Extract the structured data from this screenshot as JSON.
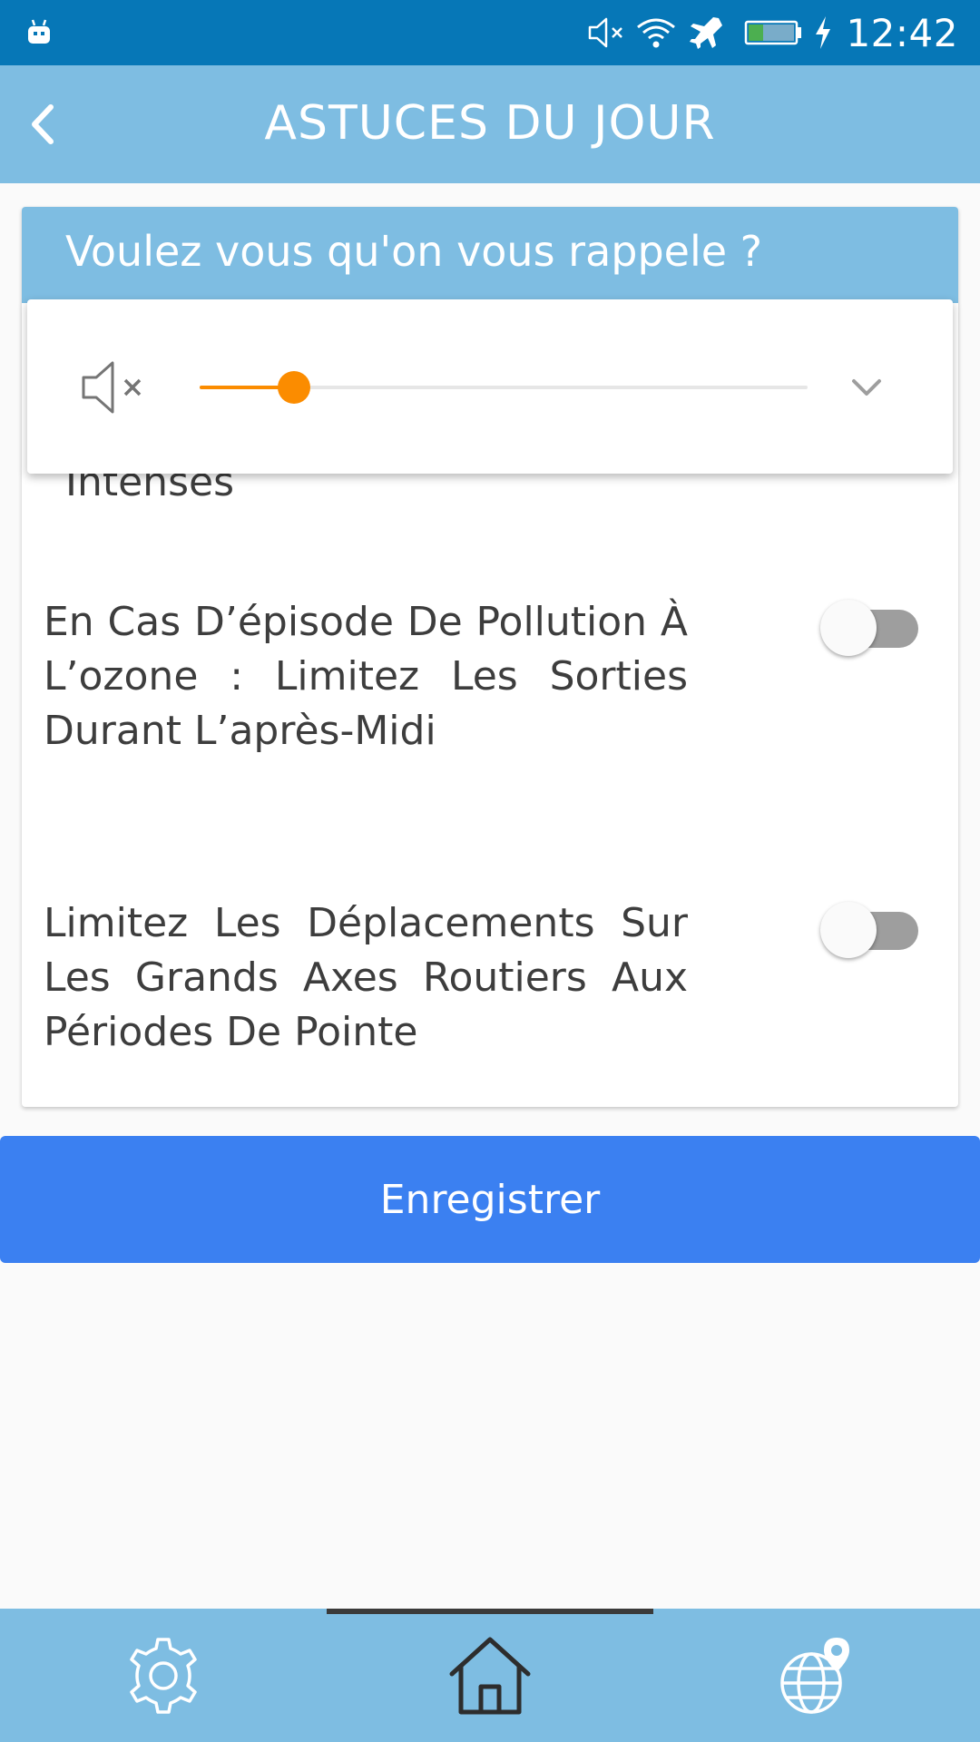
{
  "status_bar": {
    "time": "12:42",
    "icons": [
      "android-debug-icon",
      "volume-muted-icon",
      "wifi-icon",
      "airplane-mode-icon",
      "battery-charging-icon"
    ],
    "battery_level": 0.3,
    "color": "#0677b7"
  },
  "app_bar": {
    "title": "ASTUCES DU JOUR",
    "back_icon": "chevron-left-icon",
    "color": "#7ebde2"
  },
  "card": {
    "header": "Voulez vous qu'on vous rappele ?",
    "partial_item_text": "Intenses",
    "tips": [
      {
        "text": "En Cas D’épisode De Pollution À L’ozone : Limitez Les Sorties Durant L’après-Midi",
        "enabled": false
      },
      {
        "text": "Limitez Les Déplacements Sur Les Grands Axes Routiers Aux Périodes De Pointe",
        "enabled": false
      }
    ]
  },
  "volume_popup": {
    "mute_icon": "volume-muted-icon",
    "level": 0.155,
    "accent_color": "#fb8c00",
    "expand_icon": "chevron-down-icon"
  },
  "save_button": {
    "label": "Enregistrer",
    "color": "#3b80f1"
  },
  "bottom_nav": {
    "items": [
      {
        "icon": "gear-icon",
        "active": false
      },
      {
        "icon": "home-icon",
        "active": true
      },
      {
        "icon": "globe-location-icon",
        "active": false
      }
    ]
  }
}
